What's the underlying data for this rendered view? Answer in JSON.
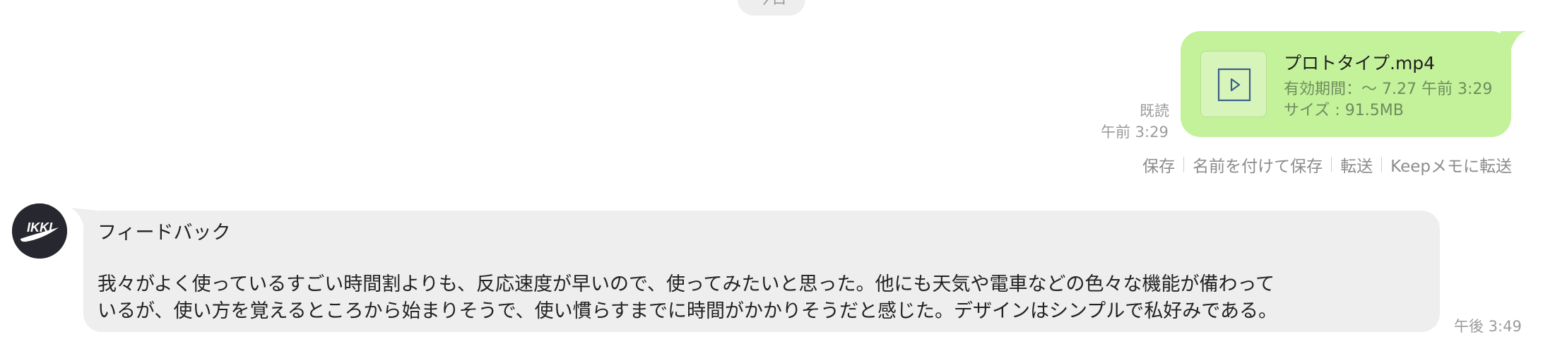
{
  "date_separator": "今日",
  "outgoing_file": {
    "file_name": "プロトタイプ.mp4",
    "expiry": "有効期間：〜 7.27 午前 3:29",
    "size": "サイズ : 91.5MB",
    "read_status": "既読",
    "time": "午前 3:29",
    "icon": "play-icon"
  },
  "file_actions": [
    "保存",
    "名前を付けて保存",
    "転送",
    "Keepメモに転送"
  ],
  "incoming_message": {
    "avatar": "IKKI",
    "title": "フィードバック",
    "lines": [
      "我々がよく使っているすごい時間割よりも、反応速度が早いので、使ってみたいと思った。他にも天気や電車などの色々な機能が備わって",
      "いるが、使い方を覚えるところから始まりそうで、使い慣らすまでに時間がかかりそうだと感じた。デザインはシンプルで私好みである。"
    ],
    "time": "午後 3:49"
  },
  "colors": {
    "outgoing_bubble": "#c4f29a",
    "incoming_bubble": "#eeeeee",
    "avatar_bg": "#27272f",
    "play_icon": "#3a5f8a",
    "meta_text": "#9b9b9b"
  }
}
